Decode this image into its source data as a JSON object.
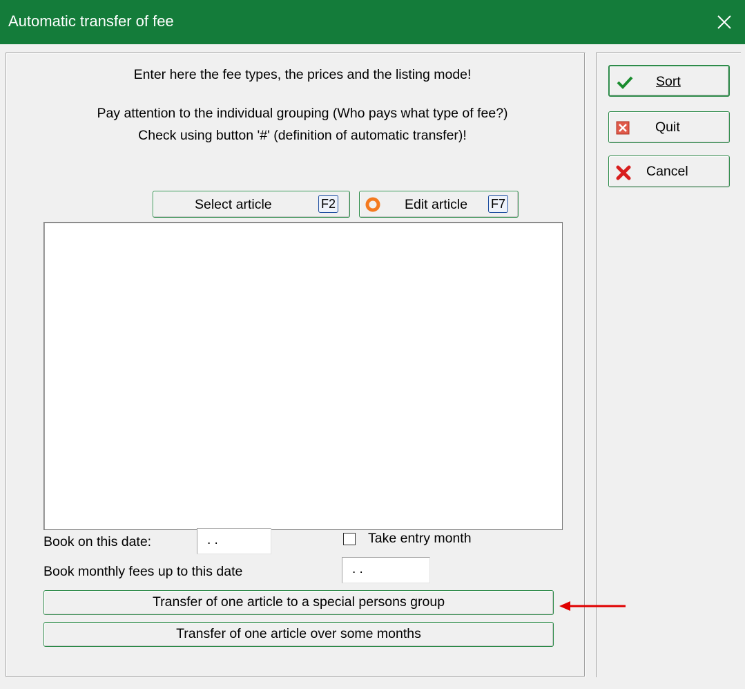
{
  "window": {
    "title": "Automatic transfer of fee"
  },
  "instructions": {
    "line1": "Enter here the fee types, the prices and the listing mode!",
    "line2": "Pay attention to the individual grouping (Who pays what type of fee?)",
    "line3": "Check using button '#' (definition of automatic transfer)!"
  },
  "toolbar": {
    "select_article": {
      "label": "Select article",
      "key": "F2"
    },
    "edit_article": {
      "label": "Edit article",
      "key": "F7"
    }
  },
  "form": {
    "book_date_label": "Book on this date:",
    "book_date_value": " .  .",
    "take_entry_month_label": "Take entry month",
    "take_entry_month_checked": false,
    "monthly_fees_label": "Book monthly fees up to this date",
    "monthly_fees_value": " .  ."
  },
  "actions": {
    "special_group": "Transfer of one article to a special persons group",
    "some_months": "Transfer of one article over some months"
  },
  "sidebar": {
    "sort": "Sort",
    "quit": "Quit",
    "cancel": "Cancel"
  },
  "colors": {
    "titlebar": "#147c3a",
    "button_border": "#2e8b4a",
    "annotation_arrow": "#e00000"
  }
}
